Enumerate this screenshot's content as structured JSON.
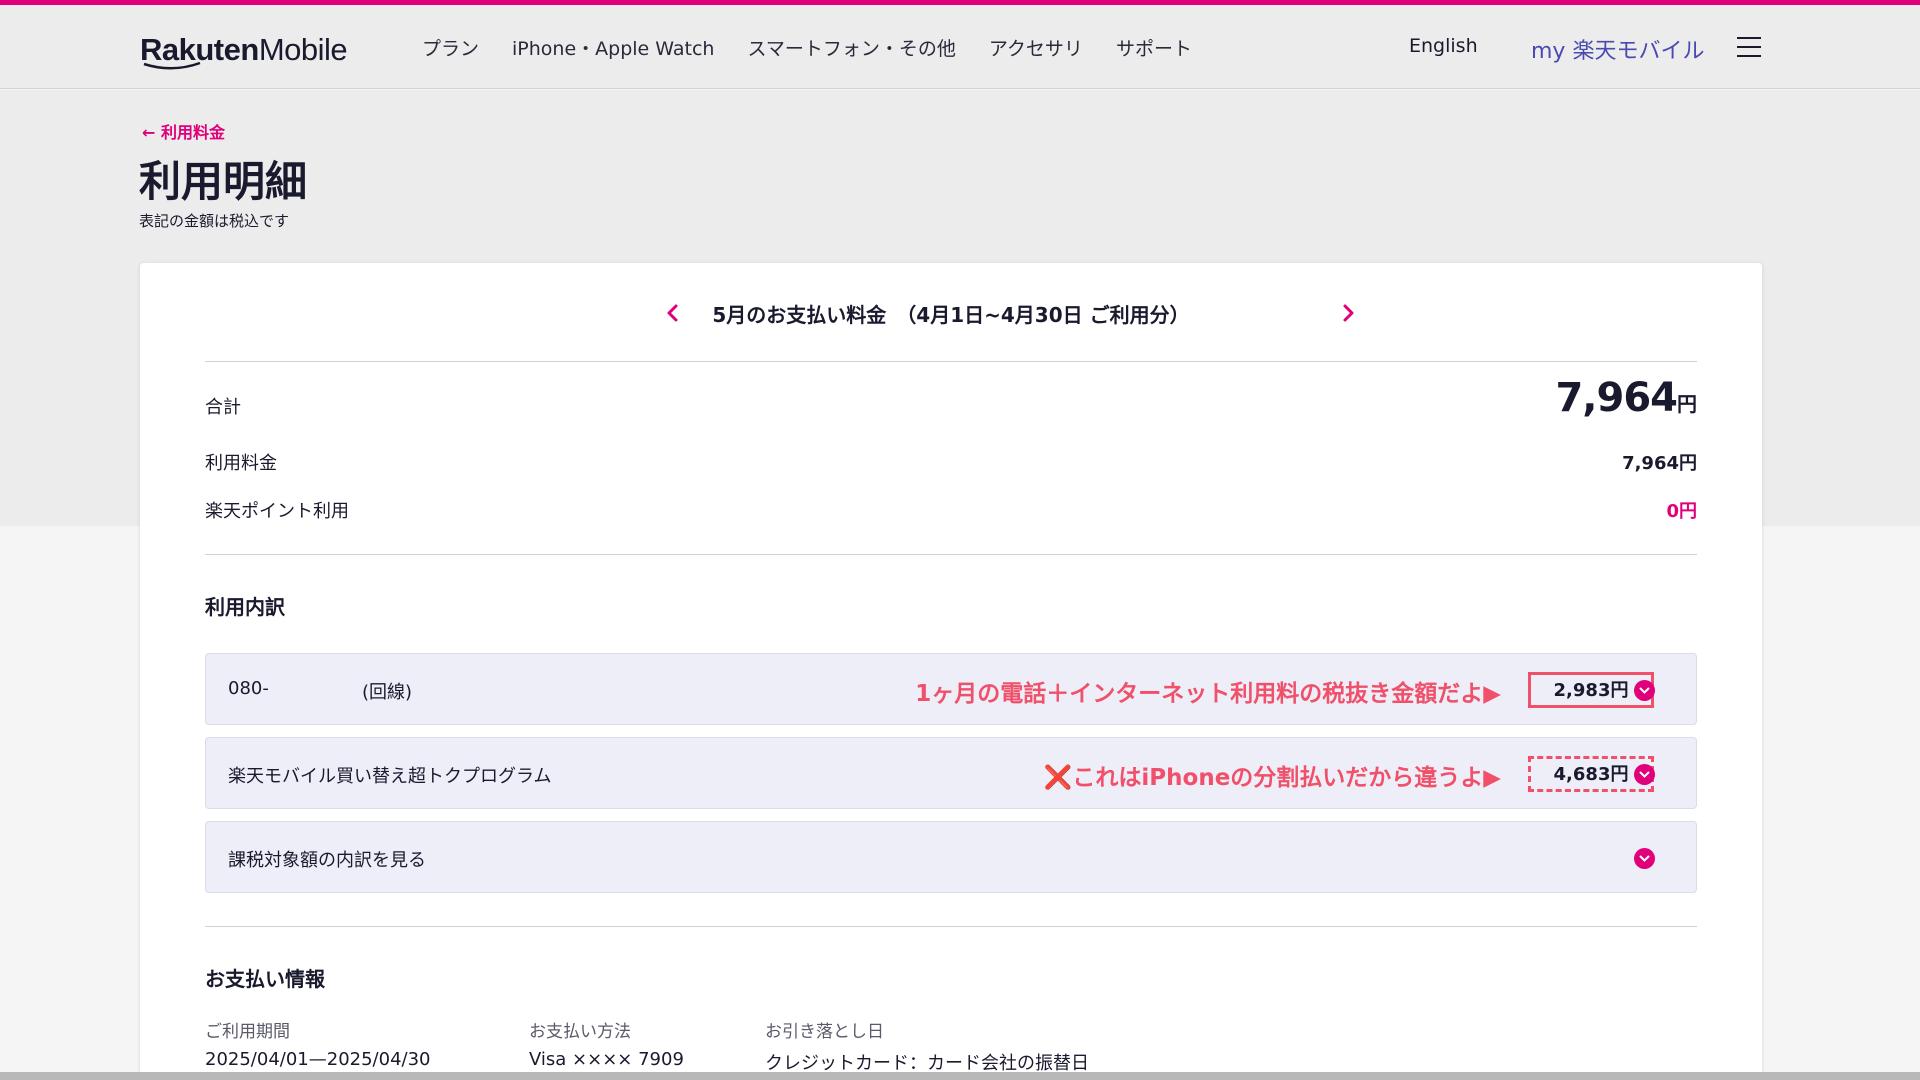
{
  "header": {
    "logo_brand": "Rakuten",
    "logo_sub": "Mobile",
    "nav": [
      "プラン",
      "iPhone・Apple Watch",
      "スマートフォン・その他",
      "アクセサリ",
      "サポート"
    ],
    "lang": "English",
    "my_link": "my 楽天モバイル"
  },
  "page": {
    "back_link": "← 利用料金",
    "title": "利用明細",
    "tax_note": "表記の金額は税込です"
  },
  "summary": {
    "period": "5月のお支払い料金　（4月1日~4月30日 ご利用分）",
    "total_label": "合計",
    "total_value": "7,964",
    "total_unit": "円",
    "usage_label": "利用料金",
    "usage_value": "7,964円",
    "points_label": "楽天ポイント利用",
    "points_value": "0円"
  },
  "breakdown": {
    "title": "利用内訳",
    "items": [
      {
        "label": "080-",
        "label2": "(回線)",
        "annotation": "1ヶ月の電話＋インターネット利用料の税抜き金額だよ▶",
        "amount": "2,983円"
      },
      {
        "label": "楽天モバイル買い替え超トクプログラム",
        "annotation": "❌これはiPhoneの分割払いだから違うよ▶",
        "amount": "4,683円"
      },
      {
        "label": "課税対象額の内訳を見る"
      }
    ]
  },
  "payment": {
    "title": "お支払い情報",
    "period_head": "ご利用期間",
    "period_value": "2025/04/01—2025/04/30",
    "method_head": "お支払い方法",
    "method_value": "Visa ×××× 7909",
    "debit_head": "お引き落とし日",
    "debit_value": "クレジットカード：カード会社の振替日"
  },
  "colors": {
    "accent": "#e0007a",
    "annotation": "#f0506a",
    "link_blue": "#4a4ab0"
  }
}
